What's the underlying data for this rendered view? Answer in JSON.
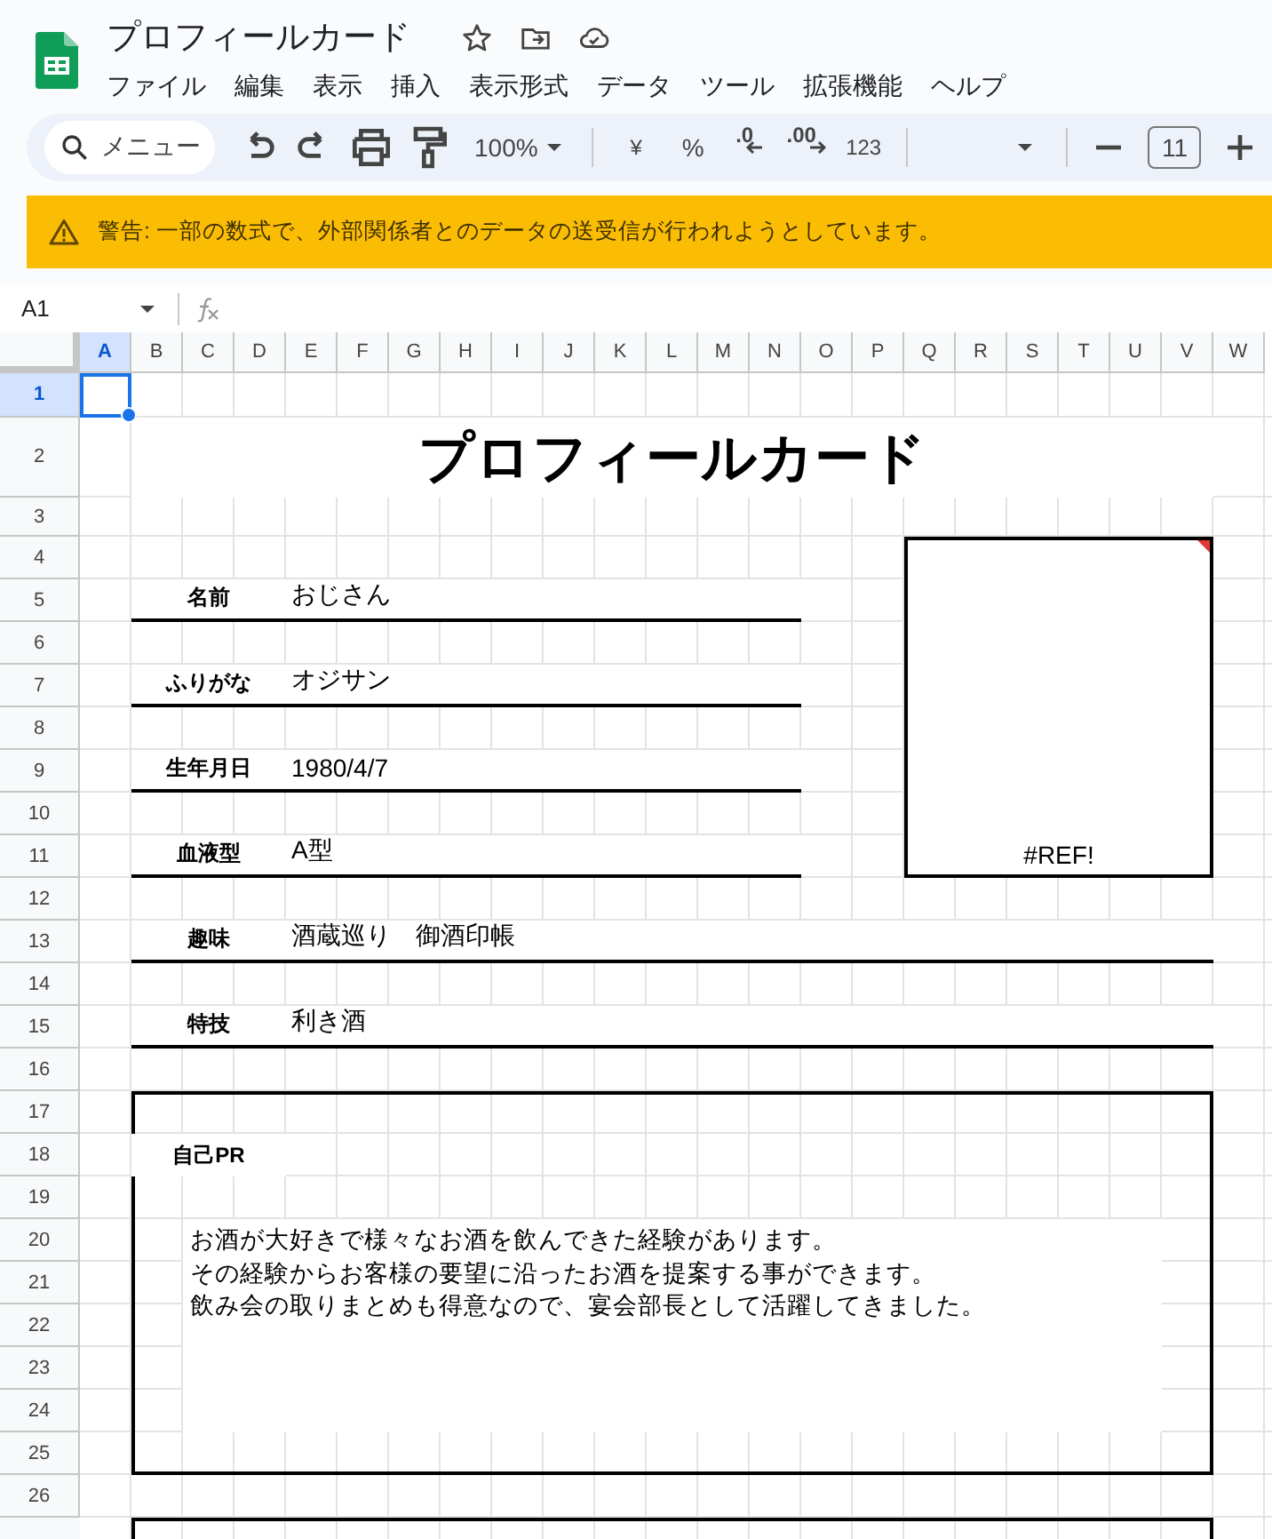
{
  "document": {
    "title": "プロフィールカード"
  },
  "menu": [
    "ファイル",
    "編集",
    "表示",
    "挿入",
    "表示形式",
    "データ",
    "ツール",
    "拡張機能",
    "ヘルプ"
  ],
  "toolbar": {
    "search": "メニュー",
    "zoom": "100%",
    "currency": "¥",
    "percent": "%",
    "decrease_decimal": ".0",
    "increase_decimal": ".00",
    "number_format": "123",
    "font_size": "11"
  },
  "warning": {
    "text": "警告: 一部の数式で、外部関係者とのデータの送受信が行われようとしています。"
  },
  "formula_bar": {
    "cell_ref": "A1"
  },
  "columns": [
    {
      "label": "A",
      "selected": true
    },
    {
      "label": "B",
      "selected": false
    },
    {
      "label": "C",
      "selected": false
    },
    {
      "label": "D",
      "selected": false
    },
    {
      "label": "E",
      "selected": false
    },
    {
      "label": "F",
      "selected": false
    },
    {
      "label": "G",
      "selected": false
    },
    {
      "label": "H",
      "selected": false
    },
    {
      "label": "I",
      "selected": false
    },
    {
      "label": "J",
      "selected": false
    },
    {
      "label": "K",
      "selected": false
    },
    {
      "label": "L",
      "selected": false
    },
    {
      "label": "M",
      "selected": false
    },
    {
      "label": "N",
      "selected": false
    },
    {
      "label": "O",
      "selected": false
    },
    {
      "label": "P",
      "selected": false
    },
    {
      "label": "Q",
      "selected": false
    },
    {
      "label": "R",
      "selected": false
    },
    {
      "label": "S",
      "selected": false
    },
    {
      "label": "T",
      "selected": false
    },
    {
      "label": "U",
      "selected": false
    },
    {
      "label": "V",
      "selected": false
    },
    {
      "label": "W",
      "selected": false
    }
  ],
  "rows": [
    {
      "label": "1",
      "selected": true
    },
    {
      "label": "2",
      "selected": false
    },
    {
      "label": "3",
      "selected": false
    },
    {
      "label": "4",
      "selected": false
    },
    {
      "label": "5",
      "selected": false
    },
    {
      "label": "6",
      "selected": false
    },
    {
      "label": "7",
      "selected": false
    },
    {
      "label": "8",
      "selected": false
    },
    {
      "label": "9",
      "selected": false
    },
    {
      "label": "10",
      "selected": false
    },
    {
      "label": "11",
      "selected": false
    },
    {
      "label": "12",
      "selected": false
    },
    {
      "label": "13",
      "selected": false
    },
    {
      "label": "14",
      "selected": false
    },
    {
      "label": "15",
      "selected": false
    },
    {
      "label": "16",
      "selected": false
    },
    {
      "label": "17",
      "selected": false
    },
    {
      "label": "18",
      "selected": false
    },
    {
      "label": "19",
      "selected": false
    },
    {
      "label": "20",
      "selected": false
    },
    {
      "label": "21",
      "selected": false
    },
    {
      "label": "22",
      "selected": false
    },
    {
      "label": "23",
      "selected": false
    },
    {
      "label": "24",
      "selected": false
    },
    {
      "label": "25",
      "selected": false
    },
    {
      "label": "26",
      "selected": false
    }
  ],
  "sheet": {
    "title": "プロフィールカード",
    "fields": [
      {
        "label": "名前",
        "value": "おじさん",
        "kind": "short"
      },
      {
        "label": "ふりがな",
        "value": "オジサン",
        "kind": "short"
      },
      {
        "label": "生年月日",
        "value": "1980/4/7",
        "kind": "short"
      },
      {
        "label": "血液型",
        "value": "A型",
        "kind": "short"
      },
      {
        "label": "趣味",
        "value": "酒蔵巡り　御酒印帳",
        "kind": "long"
      },
      {
        "label": "特技",
        "value": "利き酒",
        "kind": "long"
      }
    ],
    "photo": {
      "text": "#REF!",
      "error_marker": true
    },
    "pr": {
      "label": "自己PR",
      "lines": [
        "お酒が大好きで様々なお酒を飲んできた経験があります。",
        "その経験からお客様の要望に沿ったお酒を提案する事ができます。",
        "飲み会の取りまとめも得意なので、宴会部長として活躍してきました。"
      ]
    }
  }
}
